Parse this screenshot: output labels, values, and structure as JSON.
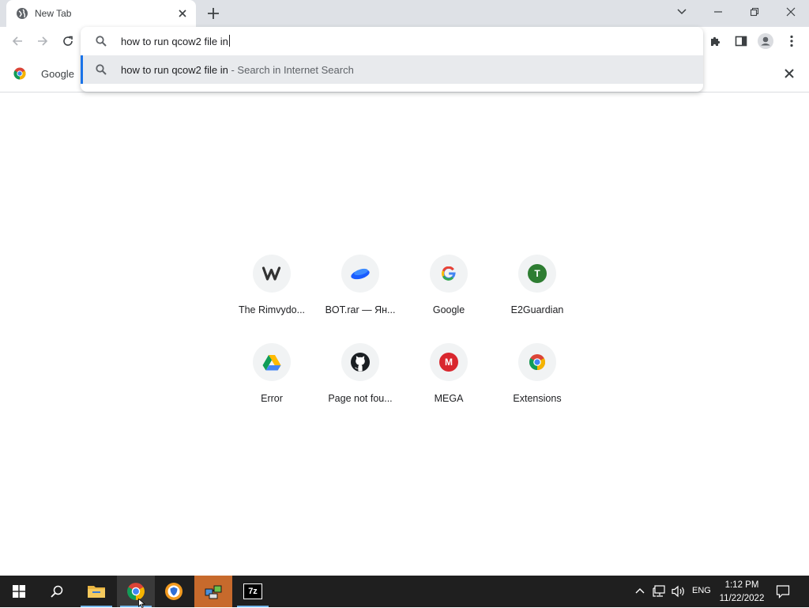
{
  "browser": {
    "tab": {
      "title": "New Tab"
    },
    "bookmarks": {
      "google_label": "Google C"
    },
    "omnibox": {
      "input_value": "how to run qcow2 file in",
      "suggestion_query": "how to run qcow2 file in",
      "suggestion_description": " - Search in Internet Search"
    },
    "accent_color": "#1a73e8"
  },
  "shortcuts": [
    {
      "label": "The Rimvydo...",
      "icon": "weebly-icon"
    },
    {
      "label": "BOT.rar — Ян...",
      "icon": "yandex-disk-icon"
    },
    {
      "label": "Google",
      "icon": "google-icon"
    },
    {
      "label": "E2Guardian",
      "icon": "letter-t-icon",
      "letter": "T"
    },
    {
      "label": "Error",
      "icon": "google-drive-icon"
    },
    {
      "label": "Page not fou...",
      "icon": "github-icon"
    },
    {
      "label": "MEGA",
      "icon": "mega-icon",
      "letter": "M"
    },
    {
      "label": "Extensions",
      "icon": "chrome-icon"
    }
  ],
  "taskbar": {
    "language": "ENG",
    "time": "1:12 PM",
    "date": "11/22/2022",
    "seven_zip_label": "7z"
  }
}
